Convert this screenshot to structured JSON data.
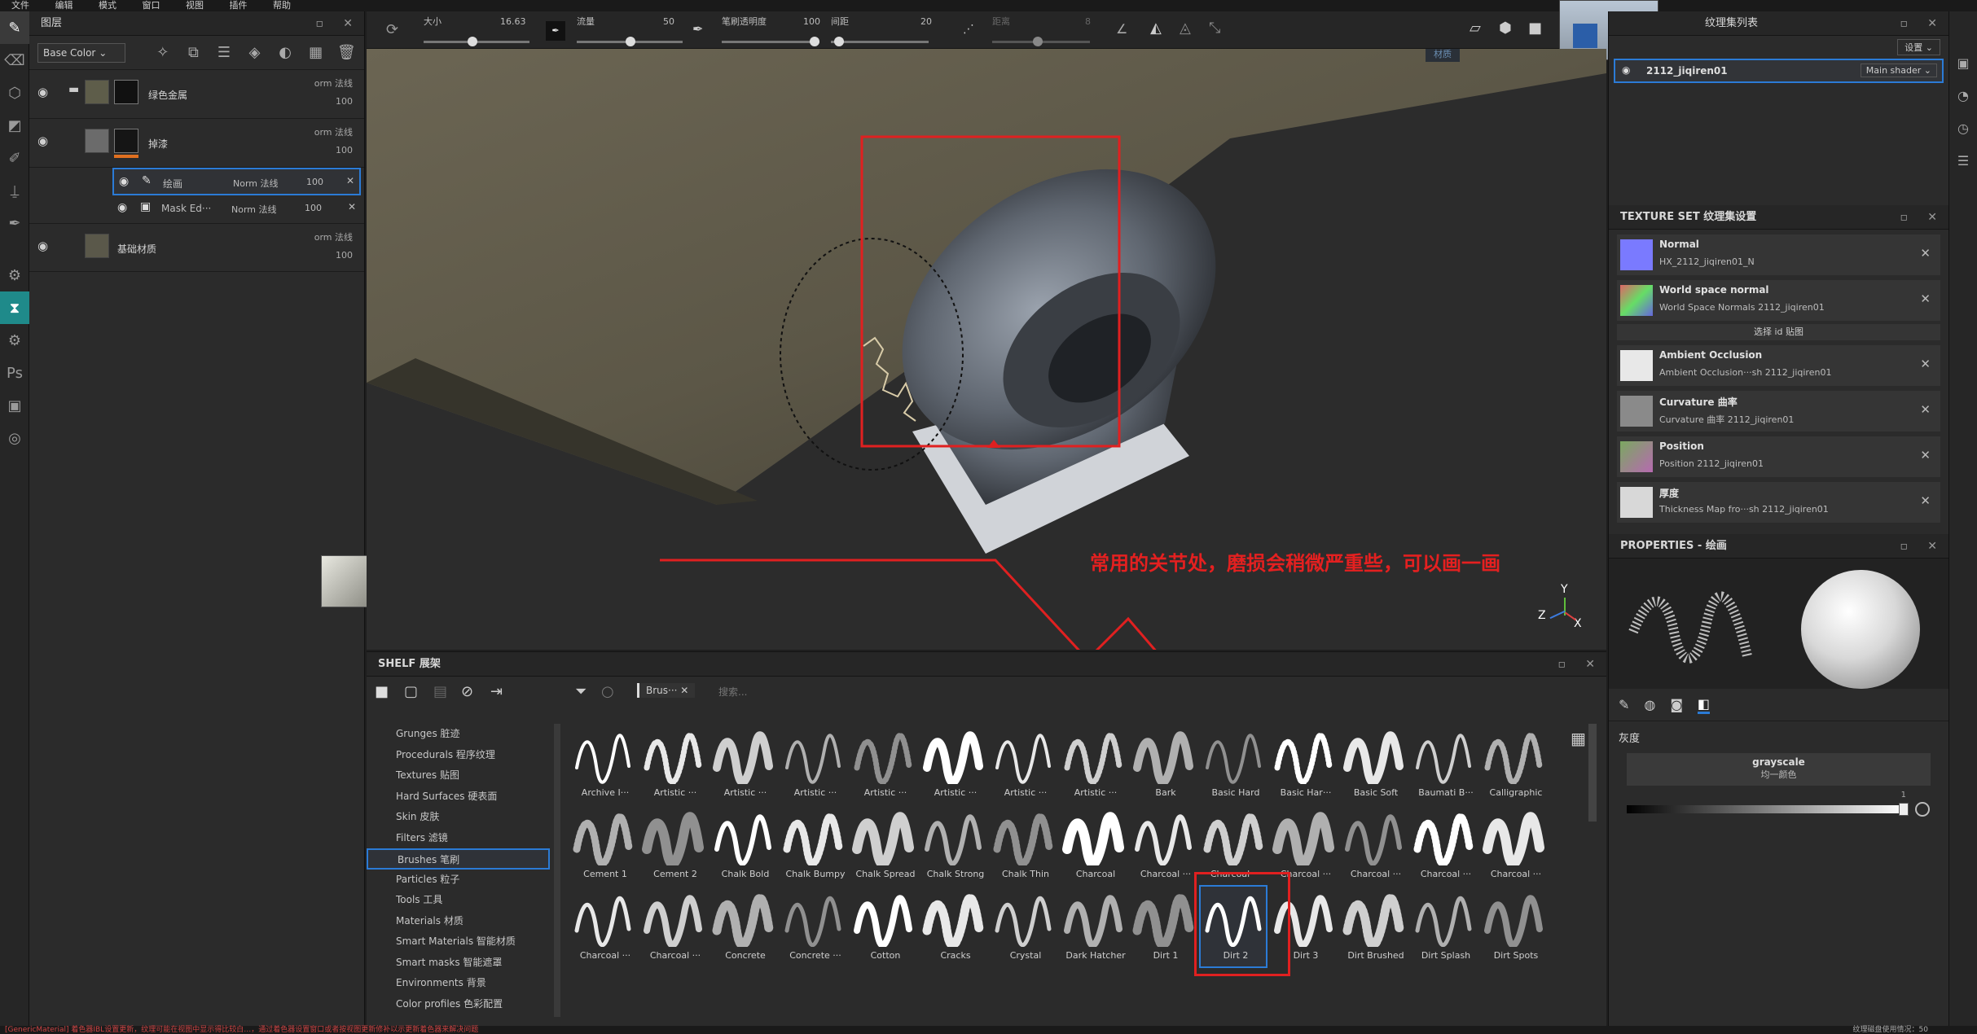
{
  "menu": [
    "文件",
    "编辑",
    "模式",
    "窗口",
    "视图",
    "插件",
    "帮助"
  ],
  "layers_panel": {
    "title": "图层",
    "channel": "Base Color",
    "layers": [
      {
        "name": "绿色金属",
        "blend": "orm 法线",
        "opacity": "100"
      },
      {
        "name": "掉漆",
        "blend": "orm 法线",
        "opacity": "100"
      }
    ],
    "sublayers": [
      {
        "name": "绘画",
        "blend": "Norm 法线",
        "opacity": "100"
      },
      {
        "name": "Mask Ed···",
        "blend": "Norm 法线",
        "opacity": "100"
      }
    ],
    "base": {
      "name": "基础材质",
      "blend": "orm 法线",
      "opacity": "100"
    }
  },
  "toolbar": {
    "size_label": "大小",
    "size_value": "16.63",
    "flow_label": "流量",
    "flow_value": "50",
    "opacity_label": "笔刷透明度",
    "opacity_value": "100",
    "spacing_label": "间距",
    "spacing_value": "20",
    "distance_label": "距离",
    "distance_value": "8"
  },
  "viewport": {
    "material_label": "材质",
    "annotation": "常用的关节处，磨损会稍微严重些，可以画一画",
    "axes": {
      "y": "Y",
      "z": "Z",
      "x": "X"
    }
  },
  "texture_set_list": {
    "title": "纹理集列表",
    "settings_label": "设置",
    "item": "2112_jiqiren01",
    "shader": "Main shader"
  },
  "texture_set_settings": {
    "title": "TEXTURE SET 纹理集设置",
    "maps": [
      {
        "name": "Normal",
        "file": "HX_2112_jiqiren01_N",
        "color": "#7a7aff"
      },
      {
        "name": "World space normal",
        "file": "World Space Normals 2112_jiqiren01",
        "color": "#9c6fbf"
      },
      {
        "name": "Ambient Occlusion",
        "file": "Ambient Occlusion···sh 2112_jiqiren01",
        "color": "#e8e8e8"
      },
      {
        "name": "Curvature 曲率",
        "file": "Curvature 曲率 2112_jiqiren01",
        "color": "#8a8a8a"
      },
      {
        "name": "Position",
        "file": "Position 2112_jiqiren01",
        "color": "#7aa860"
      },
      {
        "name": "厚度",
        "file": "Thickness Map fro···sh 2112_jiqiren01",
        "color": "#d8d8d8"
      }
    ],
    "select_id": "选择 id 贴图"
  },
  "properties": {
    "title": "PROPERTIES - 绘画",
    "section": "灰度",
    "mode": "grayscale",
    "mode_sub": "均一颜色",
    "value": "1"
  },
  "shelf": {
    "title": "SHELF 展架",
    "filter_tag": "Brus···",
    "search_placeholder": "搜索...",
    "categories": [
      "Grunges 脏迹",
      "Procedurals 程序纹理",
      "Textures 贴图",
      "Hard Surfaces 硬表面",
      "Skin 皮肤",
      "Filters 滤镜",
      "Brushes 笔刷",
      "Particles 粒子",
      "Tools 工具",
      "Materials 材质",
      "Smart Materials 智能材质",
      "Smart masks 智能遮罩",
      "Environments 背景",
      "Color profiles 色彩配置"
    ],
    "selected_category": "Brushes 笔刷",
    "brushes_row1": [
      "Archive I···",
      "Artistic ···",
      "Artistic ···",
      "Artistic ···",
      "Artistic ···",
      "Artistic ···",
      "Artistic ···",
      "Artistic ···",
      "Bark",
      "Basic Hard",
      "Basic Har···",
      "Basic Soft",
      "Baumati B···",
      "Calligraphic"
    ],
    "brushes_row2": [
      "Cement 1",
      "Cement 2",
      "Chalk Bold",
      "Chalk Bumpy",
      "Chalk Spread",
      "Chalk Strong",
      "Chalk Thin",
      "Charcoal",
      "Charcoal ···",
      "Charcoal ···",
      "Charcoal ···",
      "Charcoal ···",
      "Charcoal ···",
      "Charcoal ···"
    ],
    "brushes_row3": [
      "Charcoal ···",
      "Charcoal ···",
      "Concrete",
      "Concrete ···",
      "Cotton",
      "Cracks",
      "Crystal",
      "Dark Hatcher",
      "Dirt 1",
      "Dirt 2",
      "Dirt 3",
      "Dirt Brushed",
      "Dirt Splash",
      "Dirt Spots"
    ],
    "selected_brush": "Dirt 2"
  },
  "status": "[GenericMaterial] 着色器IBL设置更新，纹理可能在视图中显示得比较白…，通过着色器设置窗口或者按视图更新修补以示更新着色器来解决问题",
  "status_right": "纹理磁盘使用情况：50"
}
